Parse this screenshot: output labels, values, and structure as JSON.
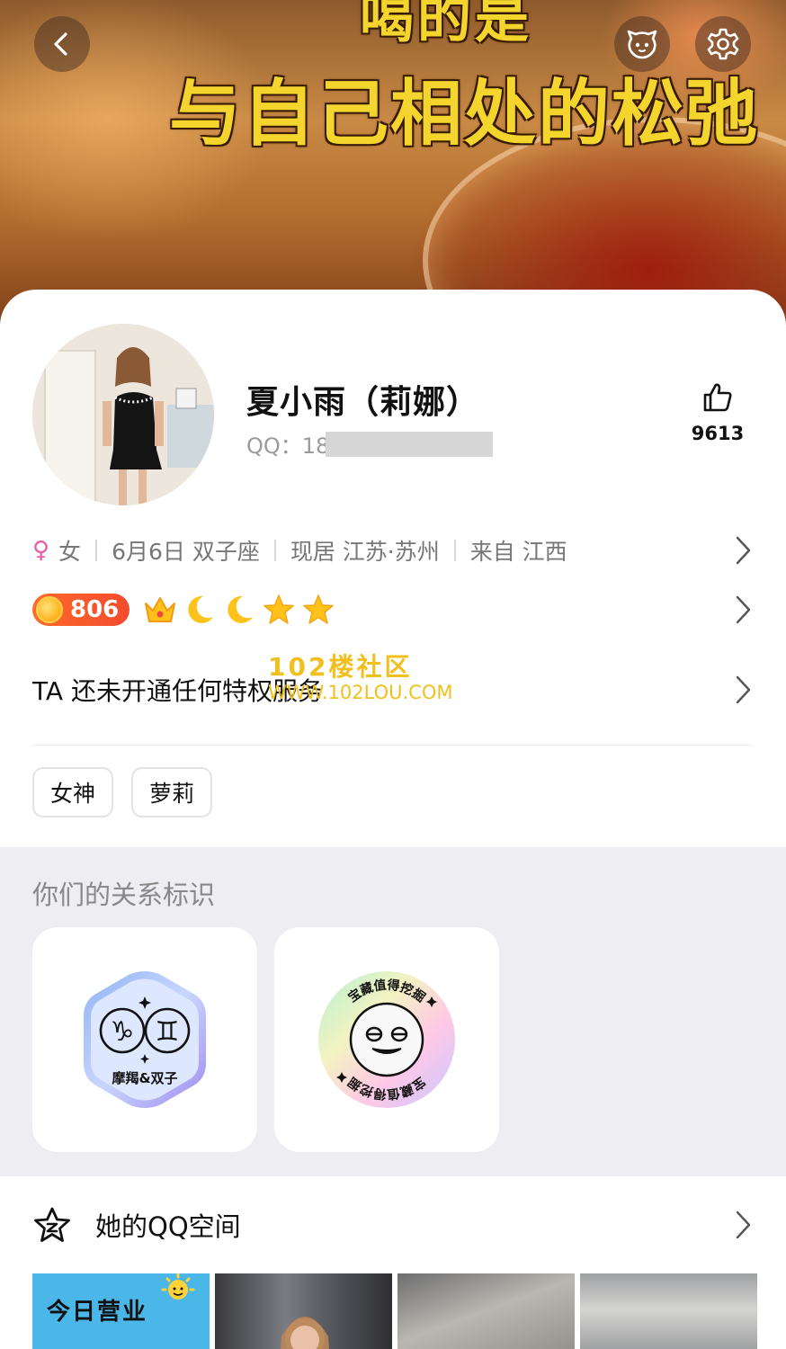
{
  "banner": {
    "line1": "喝的是",
    "line2": "与自己相处的松弛"
  },
  "header": {
    "back_icon": "chevron-left-icon",
    "pet_icon": "pet-face-icon",
    "settings_icon": "gear-icon"
  },
  "profile": {
    "nickname": "夏小雨（莉娜）",
    "qq_prefix": "QQ：18",
    "likes": "9613"
  },
  "info": {
    "gender_symbol": "♀",
    "gender": "女",
    "birthday": "6月6日 双子座",
    "location": "现居 江苏·苏州",
    "hometown": "来自 江西"
  },
  "level": {
    "number": "806",
    "icons": [
      "crown-icon",
      "moon-icon",
      "moon-icon",
      "star-icon",
      "star-icon"
    ]
  },
  "service": {
    "text": "TA 还未开通任何特权服务"
  },
  "watermark": {
    "line1": "102楼社区",
    "line2": "WWW.102LOU.COM"
  },
  "tags": [
    "女神",
    "萝莉"
  ],
  "relationship": {
    "title": "你们的关系标识",
    "badge1": {
      "label": "摩羯&双子",
      "sign_a": "♑",
      "sign_b": "♊"
    },
    "badge2": {
      "ring_text": "宝藏值得挖掘"
    }
  },
  "qzone": {
    "title": "她的QQ空间",
    "photo1_text": "今日营业"
  },
  "colors": {
    "accent_yellow": "#f3d52e",
    "level_orange": "#f24b2f",
    "gender_pink": "#e85aa8"
  }
}
